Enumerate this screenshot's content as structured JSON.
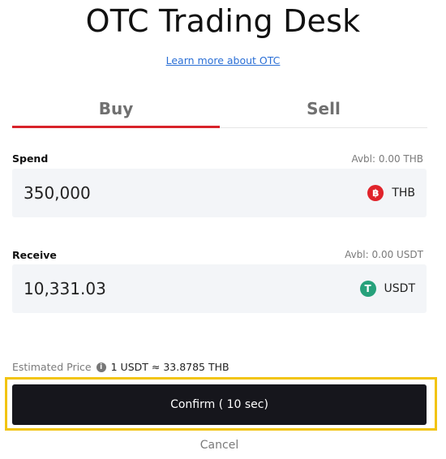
{
  "header": {
    "title": "OTC Trading Desk",
    "learn_more": "Learn more about OTC"
  },
  "tabs": [
    {
      "label": "Buy",
      "active": true
    },
    {
      "label": "Sell",
      "active": false
    }
  ],
  "spend": {
    "label": "Spend",
    "available": "Avbl: 0.00 THB",
    "value": "350,000",
    "currency": "THB",
    "icon": "baht-coin-icon",
    "icon_glyph": "฿",
    "icon_color": "#e0232b"
  },
  "receive": {
    "label": "Receive",
    "available": "Avbl: 0.00 USDT",
    "value": "10,331.03",
    "currency": "USDT",
    "icon": "tether-coin-icon",
    "icon_glyph": "T",
    "icon_color": "#26a17b"
  },
  "estimate": {
    "label": "Estimated Price",
    "value": "1 USDT ≈ 33.8785 THB"
  },
  "actions": {
    "confirm": "Confirm ( 10 sec)",
    "cancel": "Cancel"
  },
  "colors": {
    "accent": "#d8232a",
    "highlight": "#f2c40f",
    "button": "#16161c",
    "link": "#2a6fd6"
  }
}
